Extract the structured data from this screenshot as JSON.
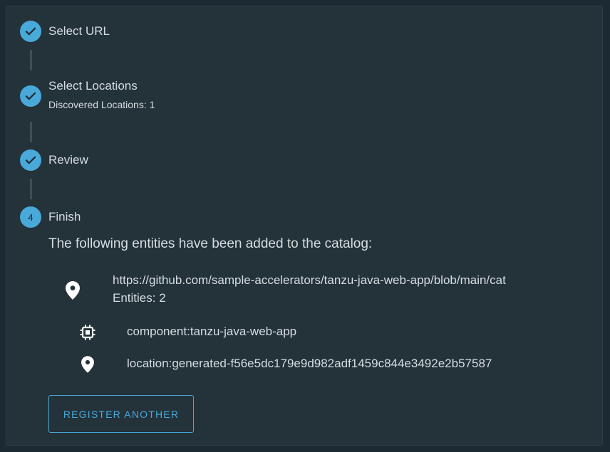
{
  "steps": [
    {
      "label": "Select URL",
      "status": "done"
    },
    {
      "label": "Select Locations",
      "status": "done",
      "sub": "Discovered Locations: 1"
    },
    {
      "label": "Review",
      "status": "done"
    },
    {
      "label": "Finish",
      "status": "active",
      "number": "4"
    }
  ],
  "finish": {
    "heading": "The following entities have been added to the catalog:",
    "location": {
      "url": "https://github.com/sample-accelerators/tanzu-java-web-app/blob/main/cat",
      "entities": "Entities: 2",
      "icon": "location-pin-icon"
    },
    "entities": [
      {
        "name": "component:tanzu-java-web-app",
        "icon": "chip-icon"
      },
      {
        "name": "location:generated-f56e5dc179e9d982adf1459c844e3492e2b57587",
        "icon": "location-pin-icon"
      }
    ],
    "register_another_label": "REGISTER ANOTHER"
  },
  "colors": {
    "accent": "#49a9d9",
    "card": "#24323a",
    "background": "#1b2a33"
  }
}
